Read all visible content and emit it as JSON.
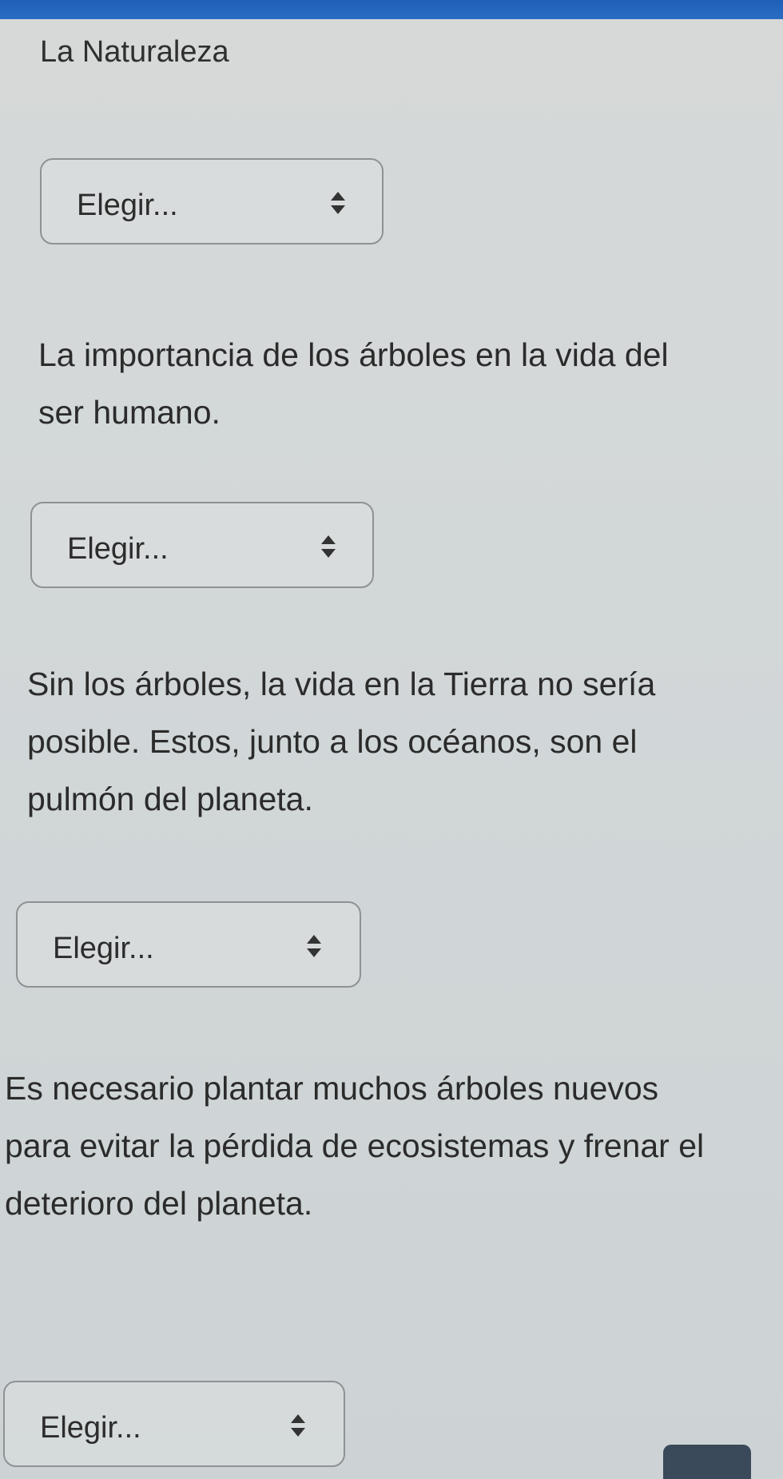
{
  "title": "La Naturaleza",
  "questions": [
    {
      "select": {
        "value": "Elegir..."
      },
      "text": "La importancia de los árboles en la vida del ser humano."
    },
    {
      "select": {
        "value": "Elegir..."
      },
      "text": "Sin los árboles, la vida en la Tierra no sería posible. Estos, junto a los océanos, son el pulmón del planeta."
    },
    {
      "select": {
        "value": "Elegir..."
      },
      "text": "Es necesario plantar muchos árboles nuevos para evitar la pérdida de ecosistemas y frenar el deterioro del planeta."
    },
    {
      "select": {
        "value": "Elegir..."
      }
    }
  ],
  "icons": {
    "select_arrow": "up-down-arrows-icon"
  },
  "colors": {
    "top_bar": "#1f5fb8",
    "border": "#8e9294"
  }
}
